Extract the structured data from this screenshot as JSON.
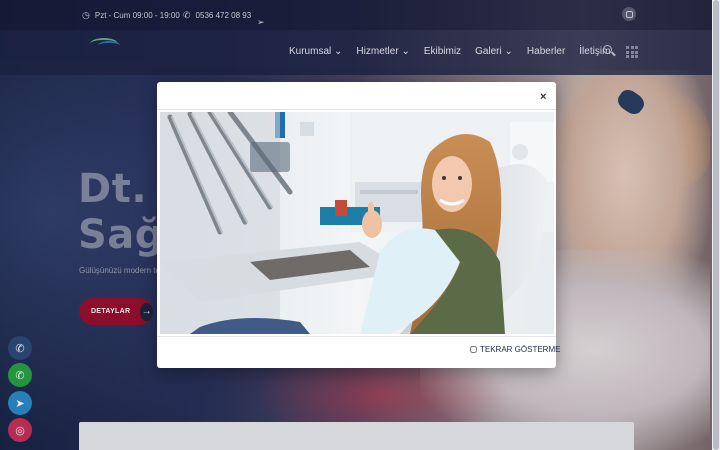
{
  "topbar": {
    "hours_text": "Pzt - Cum 09:00 - 19:00",
    "phone_text": "0536 472 08 93",
    "clock_icon": "clock-icon",
    "phone_icon": "phone-icon",
    "send_icon": "send-icon",
    "instagram_icon": "instagram-icon"
  },
  "nav": {
    "items": [
      {
        "label": "Kurumsal",
        "has_dropdown": true
      },
      {
        "label": "Hizmetler",
        "has_dropdown": true
      },
      {
        "label": "Ekibimiz",
        "has_dropdown": false
      },
      {
        "label": "Galeri",
        "has_dropdown": true
      },
      {
        "label": "Haberler",
        "has_dropdown": false
      },
      {
        "label": "İletişim",
        "has_dropdown": false
      }
    ],
    "dropdown_glyph": "⌄"
  },
  "hero": {
    "title_line1": "Dt. Em",
    "title_line2": "Sağla",
    "subtitle": "Gülüşünüzü modern te",
    "button_label": "DETAYLAR",
    "button_arrow": "→"
  },
  "modal": {
    "close_label": "×",
    "checkbox_label": "TEKRAR GÖSTERME",
    "checkbox_checked": false
  },
  "social": [
    {
      "name": "phone-icon",
      "glyph": "✆",
      "color": "#2d4a7a"
    },
    {
      "name": "whatsapp-icon",
      "glyph": "✆",
      "color": "#25a244"
    },
    {
      "name": "telegram-icon",
      "glyph": "➤",
      "color": "#2a8ac9"
    },
    {
      "name": "instagram-icon",
      "glyph": "◎",
      "color": "#c8305c"
    }
  ],
  "colors": {
    "accent": "#9a1030",
    "navy": "#1e2748"
  }
}
